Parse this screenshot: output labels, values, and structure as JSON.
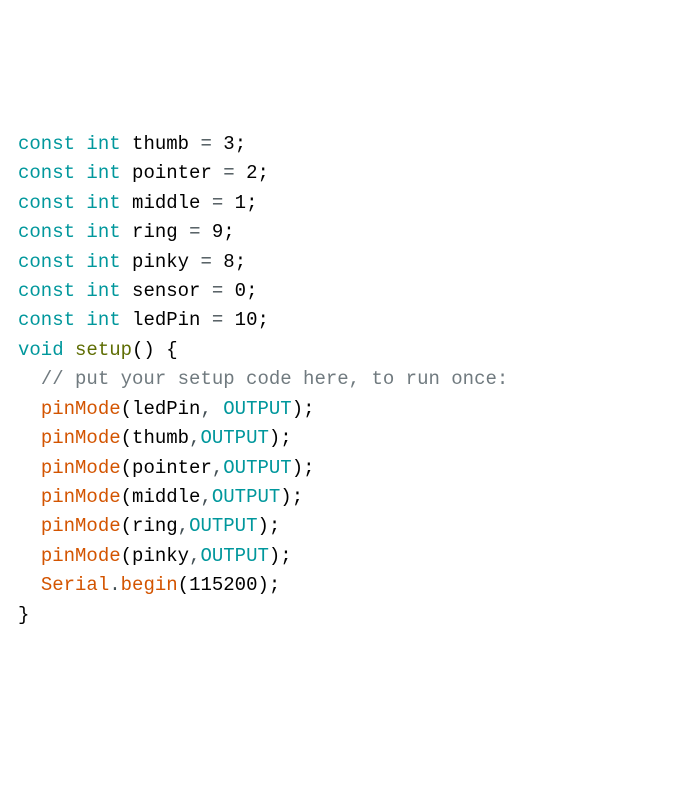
{
  "lines": [
    [
      {
        "cls": "tok-kw",
        "t": "const"
      },
      {
        "cls": "tok-var",
        "t": " "
      },
      {
        "cls": "tok-kw",
        "t": "int"
      },
      {
        "cls": "tok-var",
        "t": " thumb "
      },
      {
        "cls": "tok-op",
        "t": "="
      },
      {
        "cls": "tok-var",
        "t": " "
      },
      {
        "cls": "tok-num",
        "t": "3"
      },
      {
        "cls": "tok-var",
        "t": ";"
      }
    ],
    [
      {
        "cls": "tok-kw",
        "t": "const"
      },
      {
        "cls": "tok-var",
        "t": " "
      },
      {
        "cls": "tok-kw",
        "t": "int"
      },
      {
        "cls": "tok-var",
        "t": " pointer "
      },
      {
        "cls": "tok-op",
        "t": "="
      },
      {
        "cls": "tok-var",
        "t": " "
      },
      {
        "cls": "tok-num",
        "t": "2"
      },
      {
        "cls": "tok-var",
        "t": ";"
      }
    ],
    [
      {
        "cls": "tok-kw",
        "t": "const"
      },
      {
        "cls": "tok-var",
        "t": " "
      },
      {
        "cls": "tok-kw",
        "t": "int"
      },
      {
        "cls": "tok-var",
        "t": " middle "
      },
      {
        "cls": "tok-op",
        "t": "="
      },
      {
        "cls": "tok-var",
        "t": " "
      },
      {
        "cls": "tok-num",
        "t": "1"
      },
      {
        "cls": "tok-var",
        "t": ";"
      }
    ],
    [
      {
        "cls": "tok-kw",
        "t": "const"
      },
      {
        "cls": "tok-var",
        "t": " "
      },
      {
        "cls": "tok-kw",
        "t": "int"
      },
      {
        "cls": "tok-var",
        "t": " ring "
      },
      {
        "cls": "tok-op",
        "t": "="
      },
      {
        "cls": "tok-var",
        "t": " "
      },
      {
        "cls": "tok-num",
        "t": "9"
      },
      {
        "cls": "tok-var",
        "t": ";"
      }
    ],
    [
      {
        "cls": "tok-kw",
        "t": "const"
      },
      {
        "cls": "tok-var",
        "t": " "
      },
      {
        "cls": "tok-kw",
        "t": "int"
      },
      {
        "cls": "tok-var",
        "t": " pinky "
      },
      {
        "cls": "tok-op",
        "t": "="
      },
      {
        "cls": "tok-var",
        "t": " "
      },
      {
        "cls": "tok-num",
        "t": "8"
      },
      {
        "cls": "tok-var",
        "t": ";"
      }
    ],
    [
      {
        "cls": "tok-kw",
        "t": "const"
      },
      {
        "cls": "tok-var",
        "t": " "
      },
      {
        "cls": "tok-kw",
        "t": "int"
      },
      {
        "cls": "tok-var",
        "t": " sensor "
      },
      {
        "cls": "tok-op",
        "t": "="
      },
      {
        "cls": "tok-var",
        "t": " "
      },
      {
        "cls": "tok-num",
        "t": "0"
      },
      {
        "cls": "tok-var",
        "t": ";"
      }
    ],
    [
      {
        "cls": "tok-kw",
        "t": "const"
      },
      {
        "cls": "tok-var",
        "t": " "
      },
      {
        "cls": "tok-kw",
        "t": "int"
      },
      {
        "cls": "tok-var",
        "t": " ledPin "
      },
      {
        "cls": "tok-op",
        "t": "="
      },
      {
        "cls": "tok-var",
        "t": " "
      },
      {
        "cls": "tok-num",
        "t": "10"
      },
      {
        "cls": "tok-var",
        "t": ";"
      }
    ],
    [
      {
        "cls": "tok-var",
        "t": ""
      }
    ],
    [
      {
        "cls": "tok-kw",
        "t": "void"
      },
      {
        "cls": "tok-var",
        "t": " "
      },
      {
        "cls": "tok-name",
        "t": "setup"
      },
      {
        "cls": "tok-par",
        "t": "()"
      },
      {
        "cls": "tok-var",
        "t": " "
      },
      {
        "cls": "tok-par",
        "t": "{"
      }
    ],
    [
      {
        "cls": "tok-var",
        "t": "  "
      },
      {
        "cls": "tok-com",
        "t": "// put your setup code here, to run once:"
      }
    ],
    [
      {
        "cls": "tok-var",
        "t": "  "
      },
      {
        "cls": "tok-fn",
        "t": "pinMode"
      },
      {
        "cls": "tok-par",
        "t": "("
      },
      {
        "cls": "tok-var",
        "t": "ledPin"
      },
      {
        "cls": "tok-op",
        "t": ","
      },
      {
        "cls": "tok-var",
        "t": " "
      },
      {
        "cls": "tok-const",
        "t": "OUTPUT"
      },
      {
        "cls": "tok-par",
        "t": ")"
      },
      {
        "cls": "tok-var",
        "t": ";"
      }
    ],
    [
      {
        "cls": "tok-var",
        "t": "  "
      },
      {
        "cls": "tok-fn",
        "t": "pinMode"
      },
      {
        "cls": "tok-par",
        "t": "("
      },
      {
        "cls": "tok-var",
        "t": "thumb"
      },
      {
        "cls": "tok-op",
        "t": ","
      },
      {
        "cls": "tok-const",
        "t": "OUTPUT"
      },
      {
        "cls": "tok-par",
        "t": ")"
      },
      {
        "cls": "tok-var",
        "t": ";"
      }
    ],
    [
      {
        "cls": "tok-var",
        "t": "  "
      },
      {
        "cls": "tok-fn",
        "t": "pinMode"
      },
      {
        "cls": "tok-par",
        "t": "("
      },
      {
        "cls": "tok-var",
        "t": "pointer"
      },
      {
        "cls": "tok-op",
        "t": ","
      },
      {
        "cls": "tok-const",
        "t": "OUTPUT"
      },
      {
        "cls": "tok-par",
        "t": ")"
      },
      {
        "cls": "tok-var",
        "t": ";"
      }
    ],
    [
      {
        "cls": "tok-var",
        "t": "  "
      },
      {
        "cls": "tok-fn",
        "t": "pinMode"
      },
      {
        "cls": "tok-par",
        "t": "("
      },
      {
        "cls": "tok-var",
        "t": "middle"
      },
      {
        "cls": "tok-op",
        "t": ","
      },
      {
        "cls": "tok-const",
        "t": "OUTPUT"
      },
      {
        "cls": "tok-par",
        "t": ")"
      },
      {
        "cls": "tok-var",
        "t": ";"
      }
    ],
    [
      {
        "cls": "tok-var",
        "t": "  "
      },
      {
        "cls": "tok-fn",
        "t": "pinMode"
      },
      {
        "cls": "tok-par",
        "t": "("
      },
      {
        "cls": "tok-var",
        "t": "ring"
      },
      {
        "cls": "tok-op",
        "t": ","
      },
      {
        "cls": "tok-const",
        "t": "OUTPUT"
      },
      {
        "cls": "tok-par",
        "t": ")"
      },
      {
        "cls": "tok-var",
        "t": ";"
      }
    ],
    [
      {
        "cls": "tok-var",
        "t": "  "
      },
      {
        "cls": "tok-fn",
        "t": "pinMode"
      },
      {
        "cls": "tok-par",
        "t": "("
      },
      {
        "cls": "tok-var",
        "t": "pinky"
      },
      {
        "cls": "tok-op",
        "t": ","
      },
      {
        "cls": "tok-const",
        "t": "OUTPUT"
      },
      {
        "cls": "tok-par",
        "t": ")"
      },
      {
        "cls": "tok-var",
        "t": ";"
      }
    ],
    [
      {
        "cls": "tok-var",
        "t": "  "
      },
      {
        "cls": "tok-fn",
        "t": "Serial"
      },
      {
        "cls": "tok-op",
        "t": "."
      },
      {
        "cls": "tok-fn",
        "t": "begin"
      },
      {
        "cls": "tok-par",
        "t": "("
      },
      {
        "cls": "tok-num",
        "t": "115200"
      },
      {
        "cls": "tok-par",
        "t": ")"
      },
      {
        "cls": "tok-var",
        "t": ";"
      }
    ],
    [
      {
        "cls": "tok-par",
        "t": "}"
      }
    ]
  ]
}
